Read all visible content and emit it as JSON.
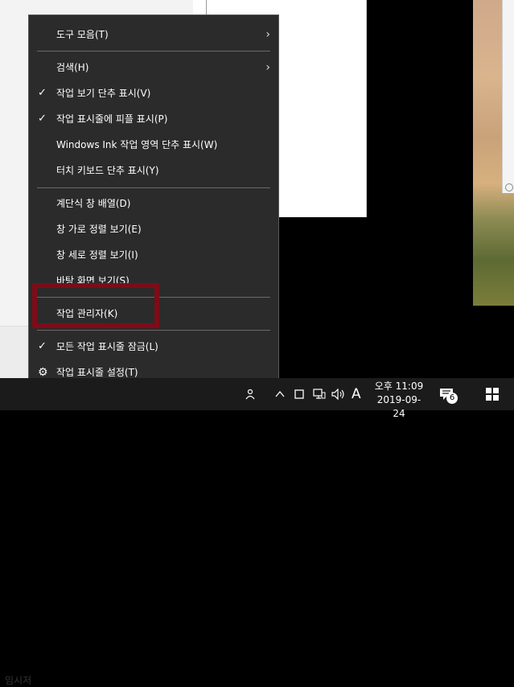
{
  "background": {
    "left_window_text": "임시저"
  },
  "menu": {
    "items": [
      {
        "label": "도구 모음(T)",
        "submenu": true,
        "checked": false
      },
      {
        "label": "검색(H)",
        "submenu": true,
        "checked": false
      },
      {
        "label": "작업 보기 단추 표시(V)",
        "submenu": false,
        "checked": true
      },
      {
        "label": "작업 표시줄에 피플 표시(P)",
        "submenu": false,
        "checked": true
      },
      {
        "label": "Windows Ink 작업 영역 단추 표시(W)",
        "submenu": false,
        "checked": false
      },
      {
        "label": "터치 키보드 단추 표시(Y)",
        "submenu": false,
        "checked": false
      },
      {
        "label": "계단식 창 배열(D)",
        "submenu": false,
        "checked": false
      },
      {
        "label": "창 가로 정렬 보기(E)",
        "submenu": false,
        "checked": false
      },
      {
        "label": "창 세로 정렬 보기(I)",
        "submenu": false,
        "checked": false
      },
      {
        "label": "바탕 화면 보기(S)",
        "submenu": false,
        "checked": false
      },
      {
        "label": "작업 관리자(K)",
        "submenu": false,
        "checked": false
      },
      {
        "label": "모든 작업 표시줄 잠금(L)",
        "submenu": false,
        "checked": true
      },
      {
        "label": "작업 표시줄 설정(T)",
        "submenu": false,
        "checked": false,
        "icon": "gear-icon"
      }
    ],
    "check_glyph": "✓",
    "arrow_glyph": "›",
    "gear_glyph": "⚙"
  },
  "highlight_color": "#7d0c18",
  "taskbar": {
    "clock_time": "오후 11:09",
    "clock_date": "2019-09-24",
    "ime_indicator": "A",
    "notification_count": "6",
    "icons": [
      "people-icon",
      "chevron-up-icon",
      "tablet-icon",
      "network-icon",
      "volume-icon",
      "notification-icon",
      "windows-start-icon"
    ]
  }
}
